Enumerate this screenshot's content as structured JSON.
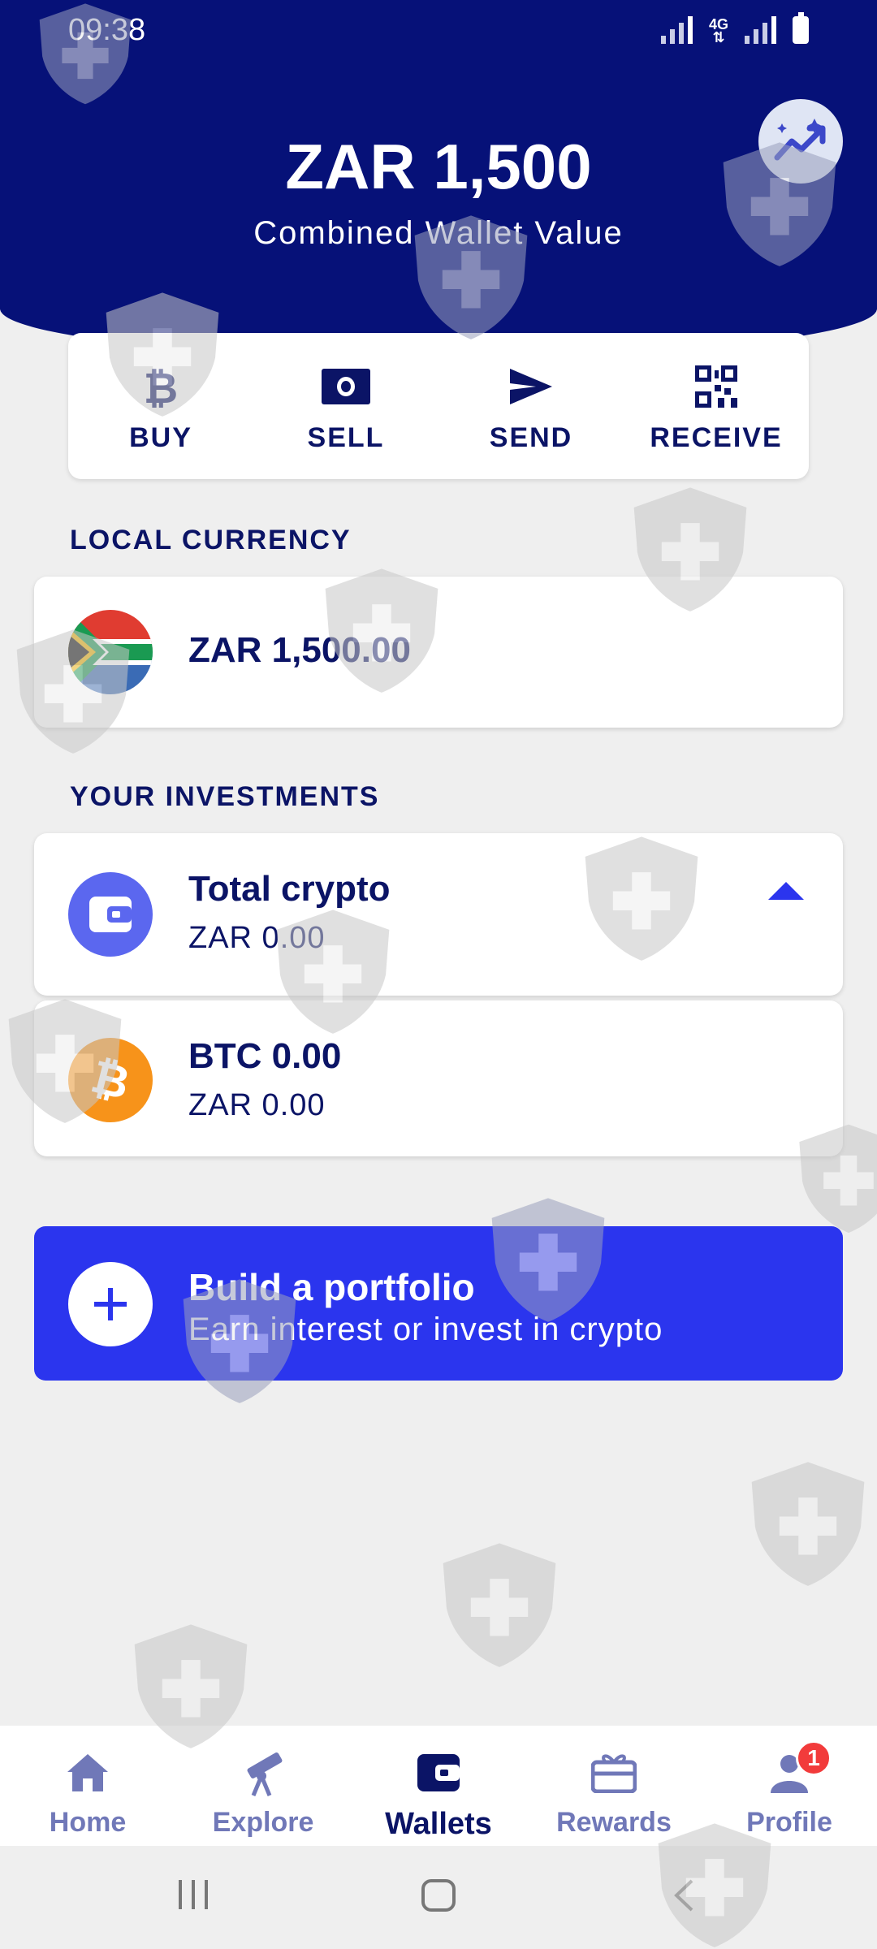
{
  "status_bar": {
    "time": "09:38",
    "network": "4G"
  },
  "header": {
    "amount": "ZAR 1,500",
    "subtitle": "Combined Wallet Value",
    "insights_icon": "trending-up-sparkle-icon"
  },
  "actions": [
    {
      "label": "BUY",
      "icon": "bitcoin-icon"
    },
    {
      "label": "SELL",
      "icon": "banknote-icon"
    },
    {
      "label": "SEND",
      "icon": "send-icon"
    },
    {
      "label": "RECEIVE",
      "icon": "qr-code-icon"
    }
  ],
  "local_currency": {
    "section_title": "LOCAL CURRENCY",
    "balance": "ZAR 1,500.00",
    "icon": "south-africa-flag-icon"
  },
  "investments": {
    "section_title": "YOUR INVESTMENTS",
    "total": {
      "title": "Total crypto",
      "value": "ZAR 0.00",
      "icon": "wallet-icon"
    },
    "btc": {
      "title": "BTC 0.00",
      "value": "ZAR 0.00",
      "icon": "bitcoin-icon"
    }
  },
  "portfolio": {
    "title": "Build a portfolio",
    "subtitle": "Earn interest or invest in crypto"
  },
  "bottom_nav": [
    {
      "label": "Home",
      "icon": "home-icon",
      "active": false
    },
    {
      "label": "Explore",
      "icon": "telescope-icon",
      "active": false
    },
    {
      "label": "Wallets",
      "icon": "wallet-icon",
      "active": true
    },
    {
      "label": "Rewards",
      "icon": "gift-card-icon",
      "active": false
    },
    {
      "label": "Profile",
      "icon": "person-icon",
      "active": false,
      "badge": "1"
    }
  ],
  "colors": {
    "navy": "#061178",
    "text": "#0b1466",
    "accent": "#2b35ee",
    "wallet_purple": "#5b67ef",
    "bitcoin_orange": "#f7931a",
    "badge_red": "#f23b3b"
  }
}
